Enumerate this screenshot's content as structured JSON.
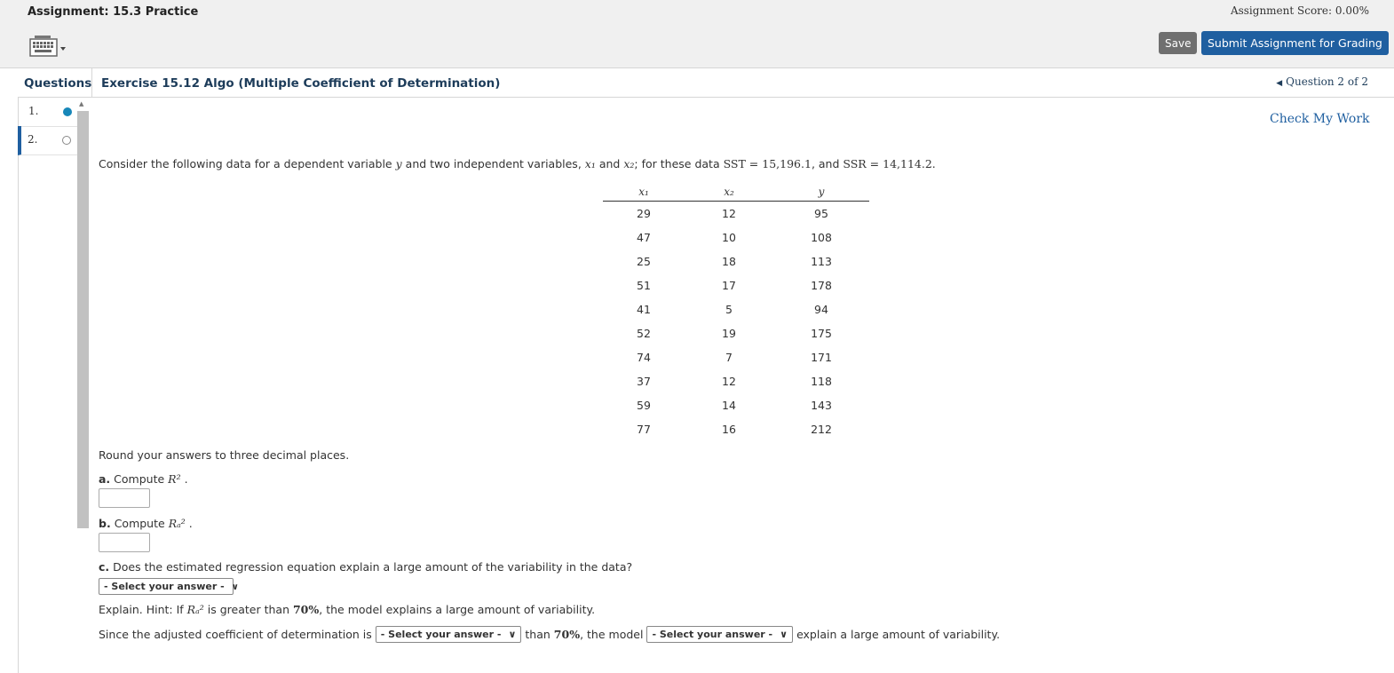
{
  "header": {
    "assignment_title": "Assignment: 15.3 Practice",
    "score": "Assignment Score: 0.00%",
    "save_label": "Save",
    "submit_label": "Submit Assignment for Grading",
    "keyboard_icon": "keyboard-icon"
  },
  "subheader": {
    "questions_label": "Questions",
    "exercise_title": "Exercise 15.12 Algo (Multiple Coefficient of Determination)",
    "question_nav": "Question 2 of 2"
  },
  "sidebar": {
    "items": [
      {
        "number": "1.",
        "status": "answered"
      },
      {
        "number": "2.",
        "status": "unanswered"
      }
    ]
  },
  "content": {
    "check_my_work": "Check My Work",
    "intro_prefix": "Consider the following data for a dependent variable",
    "intro_y": "y",
    "intro_mid": "and two independent variables,",
    "intro_x1": "x₁",
    "intro_and": "and",
    "intro_x2": "x₂",
    "intro_for": "; for these data",
    "sst": "SST = 15,196.1",
    "intro_comma": ", and",
    "ssr": "SSR = 14,114.2",
    "intro_end": ".",
    "table": {
      "headers": [
        "x₁",
        "x₂",
        "y"
      ],
      "rows": [
        [
          "29",
          "12",
          "95"
        ],
        [
          "47",
          "10",
          "108"
        ],
        [
          "25",
          "18",
          "113"
        ],
        [
          "51",
          "17",
          "178"
        ],
        [
          "41",
          "5",
          "94"
        ],
        [
          "52",
          "19",
          "175"
        ],
        [
          "74",
          "7",
          "171"
        ],
        [
          "37",
          "12",
          "118"
        ],
        [
          "59",
          "14",
          "143"
        ],
        [
          "77",
          "16",
          "212"
        ]
      ]
    },
    "round_note": "Round your answers to three decimal places.",
    "part_a_label": "a.",
    "part_a_text": "Compute",
    "part_a_math": "R²",
    "part_b_label": "b.",
    "part_b_text": "Compute",
    "part_b_math": "Rₐ²",
    "part_c_label": "c.",
    "part_c_text": "Does the estimated regression equation explain a large amount of the variability in the data?",
    "select_placeholder": "- Select your answer -",
    "explain_prefix": "Explain. Hint: If",
    "explain_math": "Rₐ²",
    "explain_mid": "is greater than",
    "explain_pct": "70%",
    "explain_end": ", the model explains a large amount of variability.",
    "since_prefix": "Since the adjusted coefficient of determination is",
    "since_than": "than",
    "since_pct": "70%",
    "since_model": ", the model",
    "since_end": "explain a large amount of variability."
  },
  "colors": {
    "accent": "#1f5fa0",
    "answered_dot": "#1787b9",
    "save_button": "#6f6f6f"
  }
}
